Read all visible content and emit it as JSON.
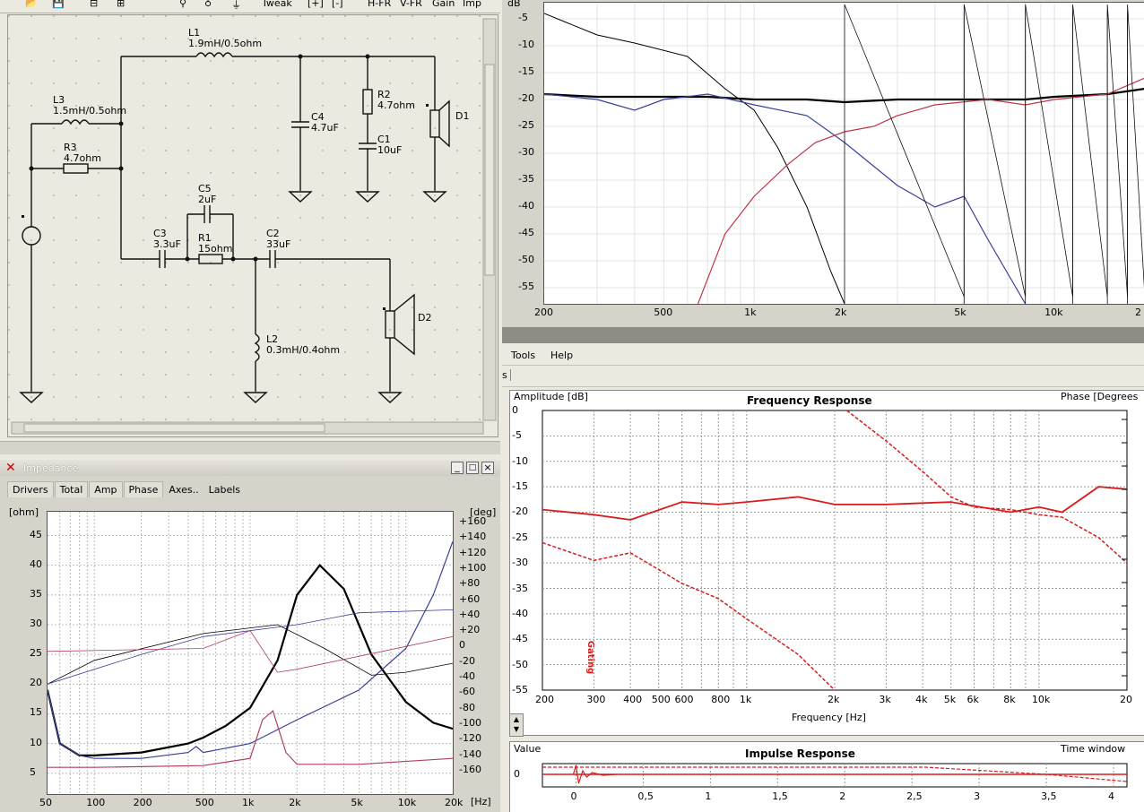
{
  "toolbar": {
    "items": [
      "Tweak",
      "[+]",
      "[-]",
      "H-FR",
      "V-FR",
      "Gain",
      "Imp"
    ]
  },
  "top_fr": {
    "y_unit": "dB",
    "y_ticks": [
      "-5",
      "-10",
      "-15",
      "-20",
      "-25",
      "-30",
      "-35",
      "-40",
      "-45",
      "-50",
      "-55"
    ],
    "x_ticks": [
      "200",
      "500",
      "1k",
      "2k",
      "5k",
      "10k",
      "2"
    ]
  },
  "schematic": {
    "components": [
      {
        "ref": "L1",
        "value": "1.9mH/0.5ohm"
      },
      {
        "ref": "L3",
        "value": "1.5mH/0.5ohm"
      },
      {
        "ref": "R3",
        "value": "4.7ohm"
      },
      {
        "ref": "C4",
        "value": "4.7uF"
      },
      {
        "ref": "R2",
        "value": "4.7ohm"
      },
      {
        "ref": "C1",
        "value": "10uF"
      },
      {
        "ref": "D1",
        "value": ""
      },
      {
        "ref": "C5",
        "value": "2uF"
      },
      {
        "ref": "C3",
        "value": "3.3uF"
      },
      {
        "ref": "R1",
        "value": "15ohm"
      },
      {
        "ref": "C2",
        "value": "33uF"
      },
      {
        "ref": "L2",
        "value": "0.3mH/0.4ohm"
      },
      {
        "ref": "D2",
        "value": ""
      }
    ]
  },
  "impedance": {
    "title": "Impedance",
    "tabs": [
      "Drivers",
      "Total",
      "Amp",
      "Phase",
      "Axes..",
      "Labels"
    ],
    "left_unit": "[ohm]",
    "right_unit": "[deg]",
    "x_unit": "[Hz]",
    "left_ticks": [
      "45",
      "40",
      "35",
      "30",
      "25",
      "20",
      "15",
      "10",
      "5"
    ],
    "right_ticks": [
      "+160",
      "+140",
      "+120",
      "+100",
      "+80",
      "+60",
      "+40",
      "+20",
      "0",
      "-20",
      "-40",
      "-60",
      "-80",
      "-100",
      "-120",
      "-140",
      "-160"
    ],
    "x_ticks": [
      "50",
      "100",
      "200",
      "500",
      "1k",
      "2k",
      "5k",
      "10k",
      "20k"
    ]
  },
  "right_menu": [
    "Tools",
    "Help"
  ],
  "fr_plot": {
    "title": "Frequency Response",
    "left_label": "Amplitude [dB]",
    "right_label": "Phase [Degrees",
    "y_ticks": [
      "0",
      "-5",
      "-10",
      "-15",
      "-20",
      "-25",
      "-30",
      "-35",
      "-40",
      "-45",
      "-50",
      "-55"
    ],
    "x_ticks": [
      "200",
      "300",
      "400",
      "500",
      "600",
      "800",
      "1k",
      "2k",
      "3k",
      "4k",
      "5k",
      "6k",
      "8k",
      "10k",
      "20"
    ],
    "x_label": "Frequency [Hz]",
    "marker": "Gating"
  },
  "impulse": {
    "title": "Impulse Response",
    "left_label": "Value",
    "right_label": "Time window",
    "y_tick": "0",
    "x_ticks": [
      "0",
      "0,5",
      "1",
      "1,5",
      "2",
      "2,5",
      "3",
      "3,5",
      "4"
    ]
  },
  "chart_data": [
    {
      "type": "line",
      "title": "",
      "ylabel": "dB",
      "ylim": [
        -58,
        -2
      ],
      "x_scale": "log",
      "series": [
        {
          "color": "#000000",
          "x": [
            200,
            300,
            400,
            600,
            800,
            1000,
            1200,
            1500,
            1800,
            2000
          ],
          "y": [
            -4,
            -8,
            -9.5,
            -12,
            -18,
            -22,
            -29,
            -40,
            -52,
            -58
          ]
        },
        {
          "color": "#000000",
          "x": [
            200,
            300,
            500,
            700,
            1000,
            1500,
            2000,
            3000,
            5000,
            8000,
            10000,
            15000,
            20000
          ],
          "y": [
            -19,
            -19.5,
            -19.5,
            -19.5,
            -20,
            -20,
            -20.5,
            -20,
            -20,
            -20,
            -19.5,
            -19,
            -18
          ]
        },
        {
          "color": "#3a3f9a",
          "x": [
            200,
            300,
            400,
            500,
            700,
            1000,
            1500,
            2000,
            3000,
            4000,
            5000,
            6000,
            8000
          ],
          "y": [
            -19,
            -20,
            -22,
            -20,
            -19,
            -21,
            -23,
            -28,
            -36,
            -40,
            -38,
            -46,
            -58
          ]
        },
        {
          "color": "#c03848",
          "x": [
            650,
            800,
            1000,
            1300,
            1600,
            2000,
            2500,
            3000,
            4000,
            6000,
            8000,
            10000,
            15000,
            20000
          ],
          "y": [
            -58,
            -45,
            -38,
            -32,
            -28,
            -26,
            -25,
            -23,
            -21,
            -20,
            -21,
            -20,
            -19,
            -16
          ]
        }
      ]
    },
    {
      "type": "line",
      "title": "",
      "ylabel": "[ohm]",
      "ylim": [
        3,
        48
      ],
      "x_scale": "log",
      "series": [
        {
          "color": "#000000",
          "x": [
            50,
            60,
            80,
            100,
            200,
            400,
            500,
            700,
            1000,
            1500,
            2000,
            2800,
            4000,
            6000,
            10000,
            15000,
            20000
          ],
          "y": [
            19,
            10,
            8,
            8,
            8.5,
            10,
            11,
            13,
            16,
            24,
            35,
            40,
            36,
            25,
            17,
            13.5,
            12.5
          ]
        },
        {
          "color": "#3a3f9a",
          "x": [
            50,
            60,
            80,
            100,
            200,
            400,
            450,
            500,
            1000,
            2000,
            5000,
            10000,
            15000,
            20000
          ],
          "y": [
            19,
            10,
            8,
            7.5,
            7.5,
            8.5,
            9.5,
            8.5,
            10,
            14,
            19,
            26,
            35,
            44
          ]
        },
        {
          "color": "#b0405a",
          "x": [
            50,
            100,
            500,
            1000,
            1200,
            1400,
            1700,
            2000,
            5000,
            20000
          ],
          "y": [
            6,
            6,
            6.3,
            7.5,
            14,
            15.5,
            8.5,
            6.5,
            6.5,
            7.5
          ]
        }
      ]
    },
    {
      "type": "line",
      "title": "Frequency Response",
      "ylabel": "Amplitude [dB]",
      "xlabel": "Frequency [Hz]",
      "ylim": [
        -55,
        0
      ],
      "x_scale": "log",
      "series": [
        {
          "color": "#d81c1c",
          "x": [
            200,
            300,
            400,
            600,
            800,
            1000,
            1500,
            2000,
            3000,
            5000,
            8000,
            10000,
            12000,
            16000,
            20000
          ],
          "y": [
            -19.5,
            -20.5,
            -21.5,
            -18,
            -18.5,
            -18,
            -17,
            -18.5,
            -18.5,
            -18,
            -20,
            -19,
            -20,
            -15,
            -15.5
          ]
        },
        {
          "color": "#d81c1c",
          "x": [
            200,
            300,
            400,
            600,
            800,
            1000,
            1500,
            2000
          ],
          "y": [
            -26,
            -29.5,
            -28,
            -34,
            -37,
            -41,
            -48,
            -55
          ]
        },
        {
          "color": "#d81c1c",
          "x": [
            2200,
            3000,
            4000,
            5000,
            6000,
            8000,
            10000,
            12000,
            16000,
            20000
          ],
          "y": [
            0,
            -6,
            -12,
            -17,
            -19,
            -19.5,
            -20.5,
            -21,
            -25,
            -30
          ]
        }
      ]
    }
  ]
}
